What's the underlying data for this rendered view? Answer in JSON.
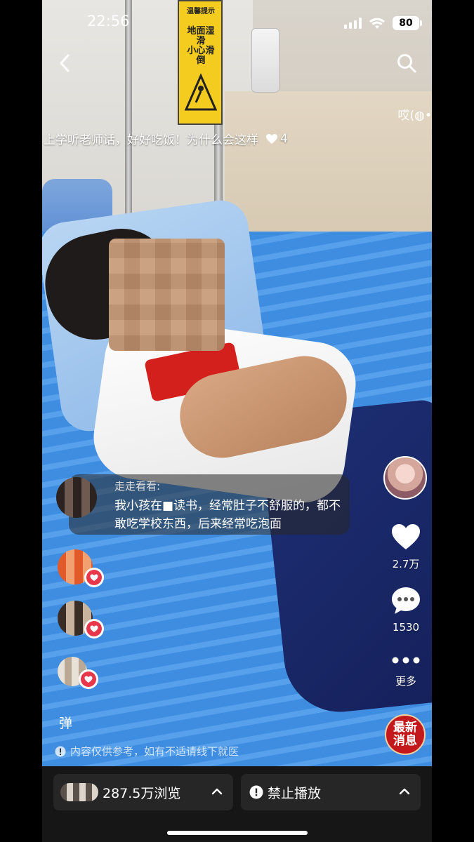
{
  "status_bar": {
    "time": "22:56",
    "battery": "80"
  },
  "header": {
    "side_text": "哎(◍•"
  },
  "video": {
    "title": "上学听老师话，好好吃饭！为什么会这样",
    "title_likes": "4",
    "sign_lines": [
      "温馨提示",
      "地面湿滑",
      "小心滑倒"
    ]
  },
  "actions": {
    "like_count": "2.7万",
    "comment_count": "1530",
    "more_label": "更多"
  },
  "news_badge": {
    "line1": "最新",
    "line2": "消息"
  },
  "comment": {
    "user": "走走看看:",
    "text": "我小孩在■读书，经常肚子不舒服的，都不敢吃学校东西，后来经常吃泡面"
  },
  "danmu_label": "弹",
  "disclaimer": "内容仅供参考，如有不适请线下就医",
  "bottom": {
    "views": "287.5万浏览",
    "block": "禁止播放"
  },
  "colors": {
    "bottom_bar": "#161616",
    "pill": "#262626",
    "news_badge": "#c3191d",
    "heart_badge": "#e8364b"
  }
}
